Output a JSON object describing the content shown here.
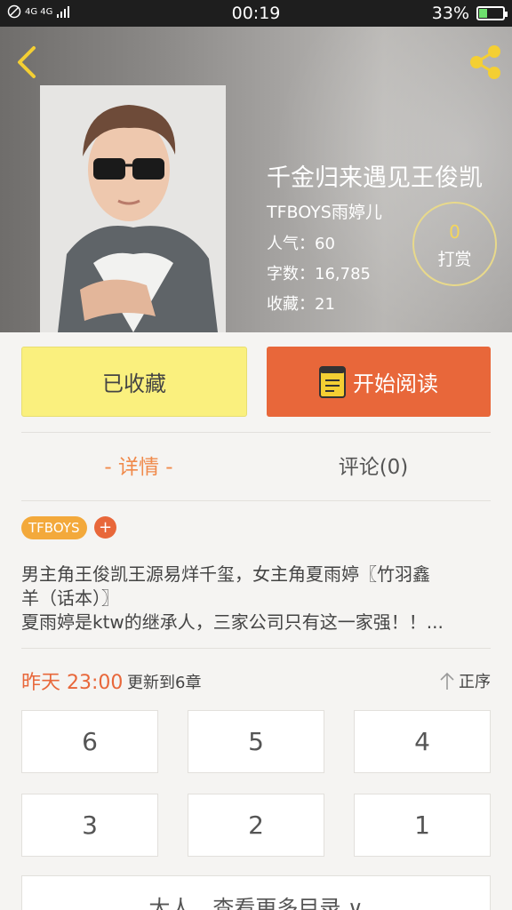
{
  "status_bar": {
    "signal": "4G 4G",
    "time": "00:19",
    "battery_percent": "33%",
    "battery_level": 0.33
  },
  "book": {
    "title": "千金归来遇见王俊凯",
    "author": "TFBOYS雨婷儿",
    "popularity": "人气：60",
    "word_count": "字数：16,785",
    "favorites": "收藏：21",
    "reward_count": "0",
    "reward_label": "打赏"
  },
  "actions": {
    "favorited_label": "已收藏",
    "read_label": "开始阅读"
  },
  "tabs": {
    "detail": "- 详情 -",
    "comments": "评论(0)"
  },
  "tags": [
    "TFBOYS"
  ],
  "add_tag": "+",
  "description": [
    "男主角王俊凯王源易烊千玺，女主角夏雨婷〖竹羽鑫",
    "羊（话本）〗",
    "夏雨婷是ktw的继承人，三家公司只有这一家强！！..."
  ],
  "update": {
    "time": "昨天 23:00",
    "text": "更新到6章",
    "order_label": "正序"
  },
  "chapters": [
    "6",
    "5",
    "4",
    "3",
    "2",
    "1"
  ],
  "more_catalog": "大人，查看更多目录 ∨",
  "colors": {
    "accent": "#e8673a",
    "favorite_bg": "#faf07e",
    "tag": "#f3a93b"
  }
}
